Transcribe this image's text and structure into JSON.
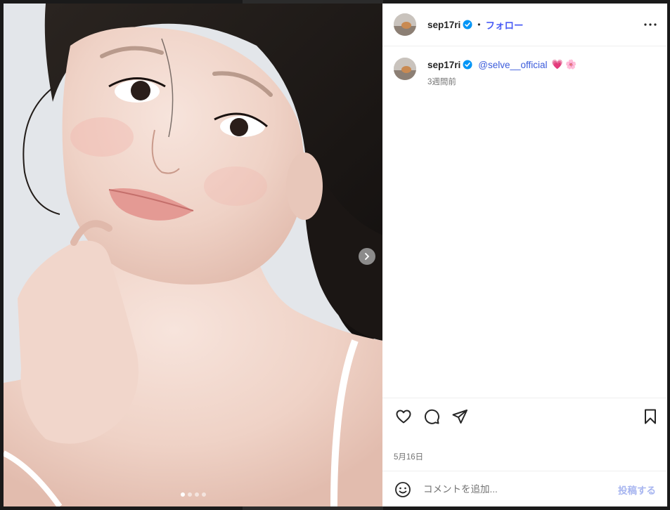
{
  "post": {
    "author": "sep17ri",
    "follow_label": "フォロー",
    "separator": "•",
    "caption": {
      "username": "sep17ri",
      "mention": "@selve__official",
      "emojis": "💗 🌸",
      "time_ago": "3週間前"
    },
    "date": "5月16日",
    "carousel": {
      "count": 4,
      "active_index": 0
    }
  },
  "comment": {
    "placeholder": "コメントを追加...",
    "post_label": "投稿する"
  },
  "icons": {
    "more": "more-horizontal-icon",
    "like": "heart-icon",
    "comment": "comment-bubble-icon",
    "share": "paper-plane-icon",
    "save": "bookmark-icon",
    "emoji": "smiley-icon",
    "next": "chevron-right-icon",
    "verified": "verified-badge-icon"
  },
  "colors": {
    "follow": "#4a5df5",
    "verified": "#0095f6",
    "mention": "#3b5bdb",
    "post_disabled": "#a8b6f0"
  }
}
